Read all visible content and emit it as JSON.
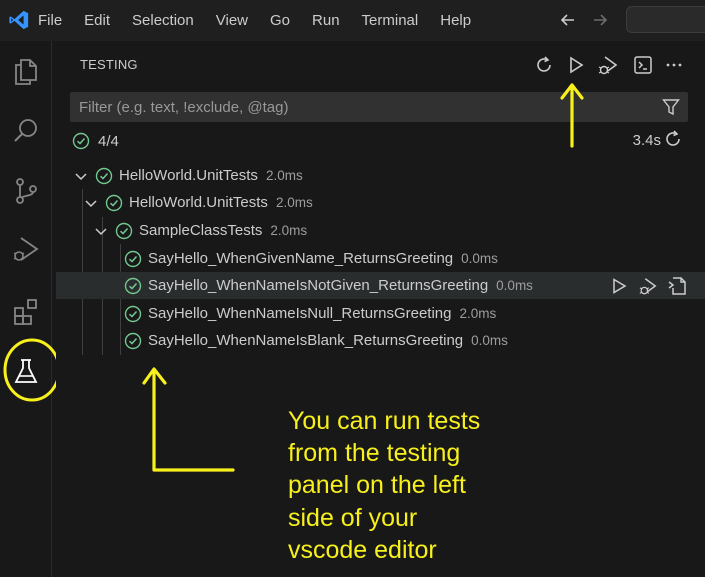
{
  "colors": {
    "accent_yellow": "#f7f01c",
    "pass_green": "#73c991",
    "vscode_blue": "#3794ff"
  },
  "menu": [
    "File",
    "Edit",
    "Selection",
    "View",
    "Go",
    "Run",
    "Terminal",
    "Help"
  ],
  "testing": {
    "title": "TESTING",
    "filter_placeholder": "Filter (e.g. text, !exclude, @tag)",
    "summary": "4/4",
    "duration": "3.4s",
    "tree": [
      {
        "name": "HelloWorld.UnitTests",
        "duration": "2.0ms",
        "level": 0,
        "expanded": true,
        "status": "passed"
      },
      {
        "name": "HelloWorld.UnitTests",
        "duration": "2.0ms",
        "level": 1,
        "expanded": true,
        "status": "passed"
      },
      {
        "name": "SampleClassTests",
        "duration": "2.0ms",
        "level": 2,
        "expanded": true,
        "status": "passed"
      },
      {
        "name": "SayHello_WhenGivenName_ReturnsGreeting",
        "duration": "0.0ms",
        "level": 3,
        "status": "passed"
      },
      {
        "name": "SayHello_WhenNameIsNotGiven_ReturnsGreeting",
        "duration": "0.0ms",
        "level": 3,
        "status": "passed",
        "selected": true
      },
      {
        "name": "SayHello_WhenNameIsNull_ReturnsGreeting",
        "duration": "2.0ms",
        "level": 3,
        "status": "passed"
      },
      {
        "name": "SayHello_WhenNameIsBlank_ReturnsGreeting",
        "duration": "0.0ms",
        "level": 3,
        "status": "passed"
      }
    ]
  },
  "annotation": {
    "lines": [
      "You can run tests",
      "from the testing",
      "panel on the left",
      "side of your",
      "vscode editor"
    ]
  },
  "icons": {
    "activity_bar": [
      "files-icon",
      "search-icon",
      "source-control-icon",
      "run-debug-icon",
      "extensions-icon",
      "testing-beaker-icon"
    ],
    "header": [
      "refresh-icon",
      "run-all-icon",
      "debug-all-icon",
      "terminal-icon",
      "more-icon"
    ]
  }
}
